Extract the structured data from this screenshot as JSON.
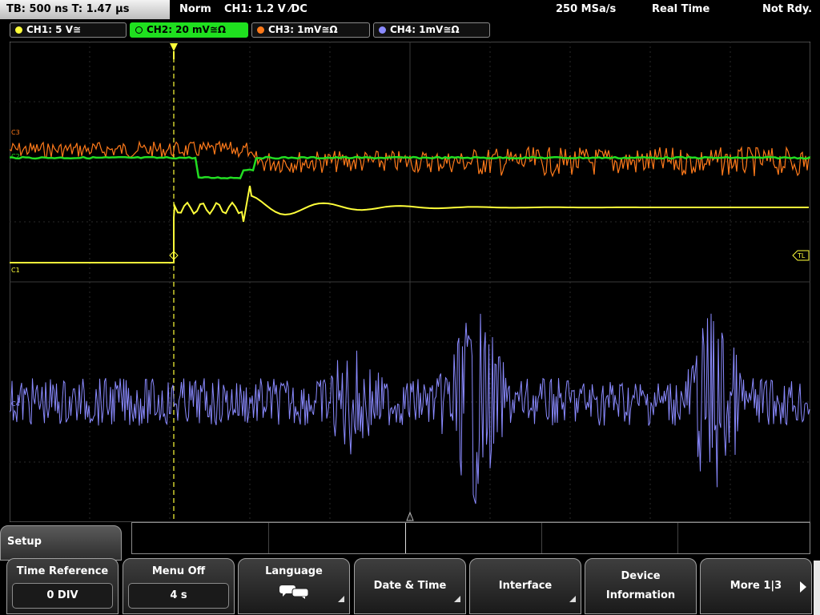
{
  "status": {
    "timebase": "TB: 500 ns   T: 1.47 µs",
    "trigger_mode": "Norm",
    "trigger_info": "CH1: 1.2 V ⁄DC",
    "sample_rate": "250 MSa/s",
    "acq_mode": "Real Time",
    "state": "Not Rdy."
  },
  "channels": [
    {
      "label": "CH1: 5 V≅",
      "color": "#ffff3a",
      "active": false
    },
    {
      "label": "CH2: 20 mV≅Ω",
      "color": "#22dd22",
      "active": true
    },
    {
      "label": "CH3: 1mV≅Ω",
      "color": "#ff7a1a",
      "active": false
    },
    {
      "label": "CH4: 1mV≅Ω",
      "color": "#8a8aff",
      "active": false
    }
  ],
  "markers": {
    "c3": "C3",
    "c2": "C2",
    "c1": "C1",
    "c4": "C4",
    "tl": "TL"
  },
  "menu": {
    "title": "Setup",
    "softkeys": [
      {
        "label": "Time Reference",
        "value": "0 DIV"
      },
      {
        "label": "Menu Off",
        "value": "4 s"
      },
      {
        "label": "Language",
        "icon": "speech-bubble-icon"
      },
      {
        "label": "Date & Time"
      },
      {
        "label": "Interface"
      },
      {
        "label": "Device",
        "label2": "Information"
      },
      {
        "label": "More 1|3"
      }
    ]
  }
}
